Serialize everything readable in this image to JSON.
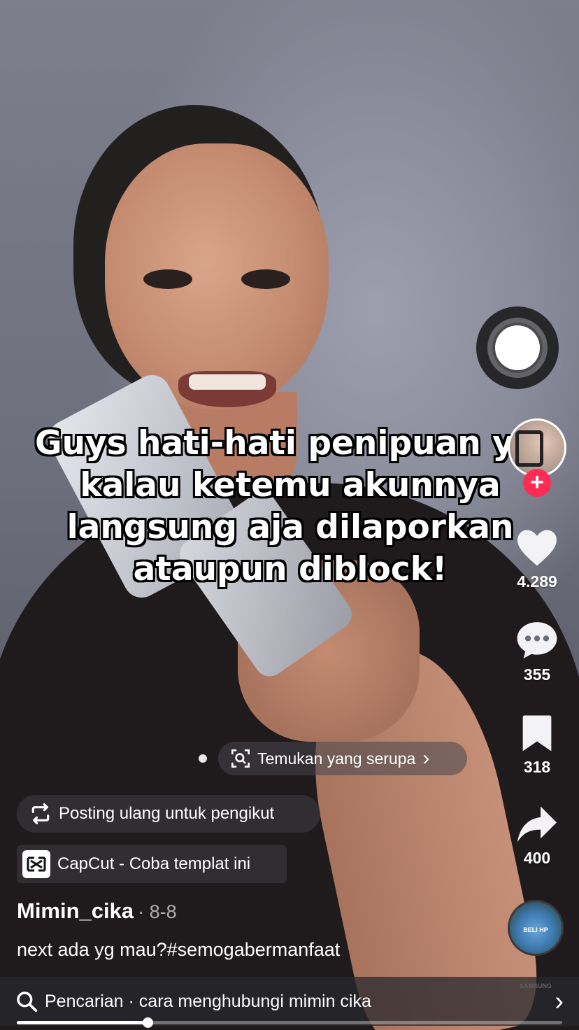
{
  "video": {
    "caption_lines": [
      "Guys hati-hati penipuan ya,",
      "kalau ketemu akunnya",
      "langsung aja dilaporkan",
      "ataupun diblock!"
    ],
    "progress": 0.24
  },
  "rail": {
    "likes": "4.289",
    "comments": "355",
    "saves": "318",
    "shares": "400",
    "follow_symbol": "+"
  },
  "similar": {
    "label": "Temukan yang serupa",
    "arrow": "›"
  },
  "repost": {
    "label": "Posting ulang untuk pengikut"
  },
  "capcut": {
    "label": "CapCut - Coba templat ini"
  },
  "post": {
    "author": "Mimin_cika",
    "date": "· 8-8",
    "description": "next ada yg mau?#semogabermanfaat"
  },
  "music": {
    "disc_text": "BELI HP SAMSUNG"
  },
  "search": {
    "label": "Pencarian · cara menghubungi mimin cika",
    "chevron": "›"
  },
  "colors": {
    "follow": "#fe2c55",
    "text": "#ffffff"
  }
}
